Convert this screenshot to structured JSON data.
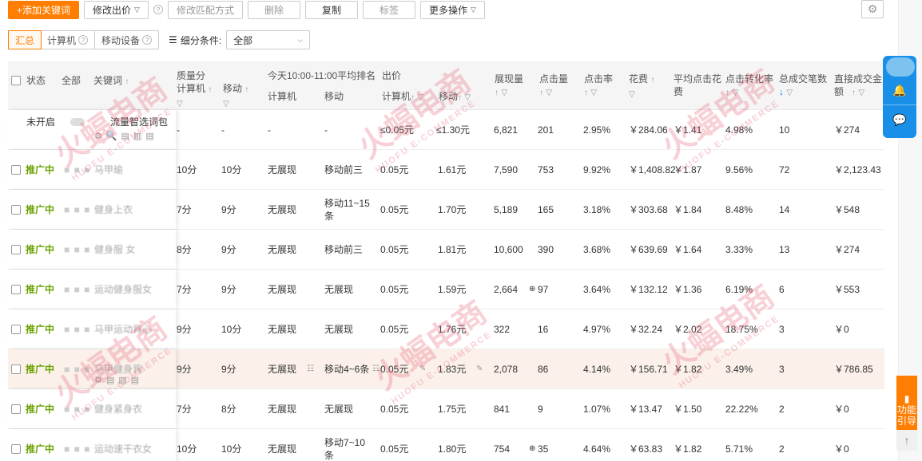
{
  "toolbar": {
    "add_keyword": "+添加关键词",
    "modify_bid": "修改出价",
    "modify_match": "修改匹配方式",
    "delete": "删除",
    "copy": "复制",
    "tag": "标签",
    "more": "更多操作"
  },
  "filter": {
    "tabs": [
      "汇总",
      "计算机",
      "移动设备"
    ],
    "label": "细分条件:",
    "select_value": "全部"
  },
  "headers": {
    "status": "状态",
    "status_filter": "全部",
    "keyword": "关键词",
    "quality": "质量分",
    "quality_pc": "计算机",
    "quality_mobile": "移动",
    "rank_title": "今天10:00-11:00平均排名",
    "rank_pc": "计算机",
    "rank_mobile": "移动",
    "bid_title": "出价",
    "bid_pc": "计算机",
    "bid_mobile": "移动",
    "impressions": "展现量",
    "clicks": "点击量",
    "ctr": "点击率",
    "cost": "花费",
    "cpc": "平均点击花费",
    "cvr": "点击转化率",
    "conversions": "总成交笔数",
    "gmv": "直接成交金额"
  },
  "summary_row": {
    "status": "未开启",
    "keyword": "流量智选词包",
    "quality_pc": "-",
    "quality_mobile": "-",
    "rank_pc": "-",
    "rank_mobile": "-",
    "bid_pc": "≤0.05元",
    "bid_mobile": "≤1.30元",
    "impressions": "6,821",
    "clicks": "201",
    "ctr": "2.95%",
    "cost": "￥284.06",
    "cpc": "￥1.41",
    "cvr": "4.98%",
    "conversions": "10",
    "gmv": "￥274"
  },
  "rows": [
    {
      "status": "推广中",
      "keyword": "马甲瑜",
      "quality_pc": "10分",
      "quality_mobile": "10分",
      "rank_pc": "无展现",
      "rank_mobile": "移动前三",
      "bid_pc": "0.05元",
      "bid_mobile": "1.61元",
      "impressions": "7,590",
      "clicks": "753",
      "ctr": "9.92%",
      "cost": "￥1,408.82",
      "cpc": "￥1.87",
      "cvr": "9.56%",
      "conversions": "72",
      "gmv": "￥2,123.43"
    },
    {
      "status": "推广中",
      "keyword": "健身上衣",
      "quality_pc": "7分",
      "quality_mobile": "9分",
      "rank_pc": "无展现",
      "rank_mobile": "移动11~15条",
      "bid_pc": "0.05元",
      "bid_mobile": "1.70元",
      "impressions": "5,189",
      "clicks": "165",
      "ctr": "3.18%",
      "cost": "￥303.68",
      "cpc": "￥1.84",
      "cvr": "8.48%",
      "conversions": "14",
      "gmv": "￥548"
    },
    {
      "status": "推广中",
      "keyword": "健身服 女",
      "quality_pc": "8分",
      "quality_mobile": "9分",
      "rank_pc": "无展现",
      "rank_mobile": "移动前三",
      "bid_pc": "0.05元",
      "bid_mobile": "1.81元",
      "impressions": "10,600",
      "clicks": "390",
      "ctr": "3.68%",
      "cost": "￥639.69",
      "cpc": "￥1.64",
      "cvr": "3.33%",
      "conversions": "13",
      "gmv": "￥274"
    },
    {
      "status": "推广中",
      "keyword": "运动健身服女",
      "quality_pc": "7分",
      "quality_mobile": "9分",
      "rank_pc": "无展现",
      "rank_mobile": "无展现",
      "bid_pc": "0.05元",
      "bid_mobile": "1.59元",
      "impressions": "2,664",
      "clicks": "97",
      "ctr": "3.64%",
      "cost": "￥132.12",
      "cpc": "￥1.36",
      "cvr": "6.19%",
      "conversions": "6",
      "gmv": "￥553"
    },
    {
      "status": "推广中",
      "keyword": "马甲运动背心",
      "quality_pc": "9分",
      "quality_mobile": "10分",
      "rank_pc": "无展现",
      "rank_mobile": "无展现",
      "bid_pc": "0.05元",
      "bid_mobile": "1.76元",
      "impressions": "322",
      "clicks": "16",
      "ctr": "4.97%",
      "cost": "￥32.24",
      "cpc": "￥2.02",
      "cvr": "18.75%",
      "conversions": "3",
      "gmv": "￥0"
    },
    {
      "status": "推广中",
      "keyword": "马甲健身背",
      "quality_pc": "9分",
      "quality_mobile": "9分",
      "rank_pc": "无展现",
      "rank_mobile": "移动4~6条",
      "bid_pc": "0.05元",
      "bid_mobile": "1.83元",
      "impressions": "2,078",
      "clicks": "86",
      "ctr": "4.14%",
      "cost": "￥156.71",
      "cpc": "￥1.82",
      "cvr": "3.49%",
      "conversions": "3",
      "gmv": "￥786.85"
    },
    {
      "status": "推广中",
      "keyword": "健身紧身衣",
      "quality_pc": "7分",
      "quality_mobile": "8分",
      "rank_pc": "无展现",
      "rank_mobile": "无展现",
      "bid_pc": "0.05元",
      "bid_mobile": "1.75元",
      "impressions": "841",
      "clicks": "9",
      "ctr": "1.07%",
      "cost": "￥13.47",
      "cpc": "￥1.50",
      "cvr": "22.22%",
      "conversions": "2",
      "gmv": "￥0"
    },
    {
      "status": "推广中",
      "keyword": "运动速干衣女",
      "quality_pc": "10分",
      "quality_mobile": "10分",
      "rank_pc": "无展现",
      "rank_mobile": "移动7~10条",
      "bid_pc": "0.05元",
      "bid_mobile": "1.80元",
      "impressions": "754",
      "clicks": "35",
      "ctr": "4.64%",
      "cost": "￥63.83",
      "cpc": "￥1.82",
      "cvr": "5.71%",
      "conversions": "2",
      "gmv": "￥0"
    }
  ],
  "side": {
    "guide": "功能引导"
  },
  "watermark": {
    "cn": "火蝠电商",
    "en": "HUOFU E-COMMERCE"
  },
  "colors": {
    "accent": "#ff7d00",
    "status_active": "#6aa300",
    "float_panel": "#1a8fe8",
    "highlight_row": "#fbf1ea"
  }
}
